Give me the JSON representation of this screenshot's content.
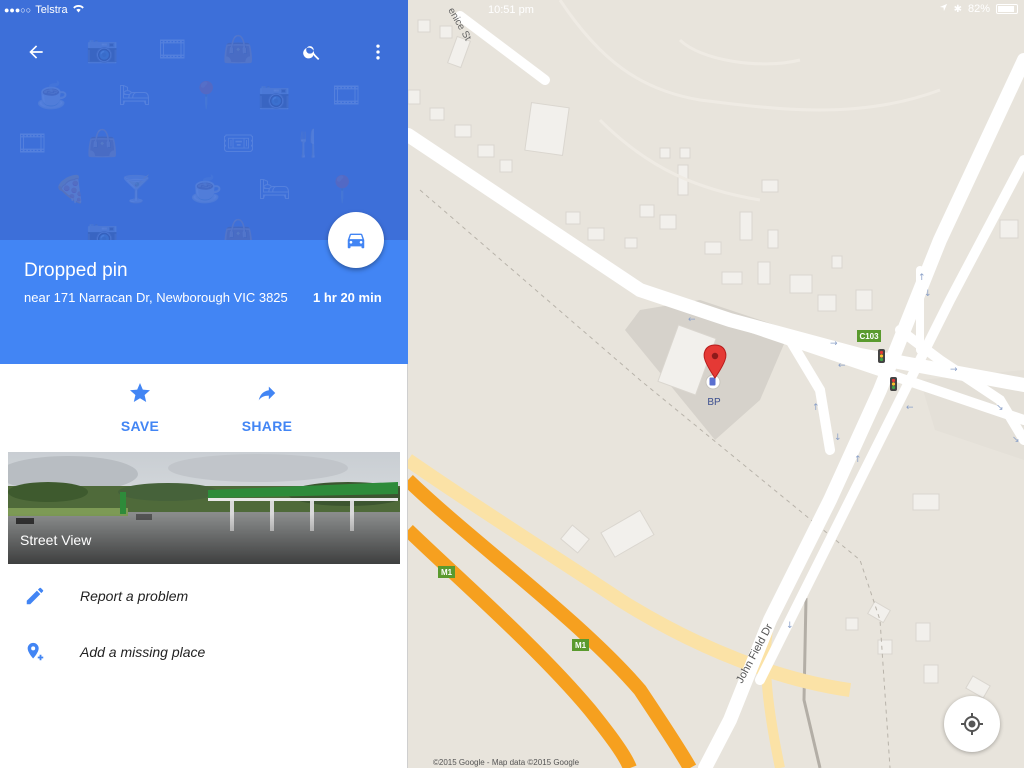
{
  "status_bar": {
    "signal": "●●●○○",
    "carrier": "Telstra",
    "time": "10:51 pm",
    "battery": "82%"
  },
  "header": {
    "back_icon": "arrow-left-icon",
    "search_icon": "search-icon",
    "more_icon": "more-vert-icon"
  },
  "place": {
    "title": "Dropped pin",
    "address": "near 171 Narracan Dr, Newborough VIC 3825",
    "drive_time": "1 hr 20 min"
  },
  "actions": {
    "save_label": "SAVE",
    "share_label": "SHARE"
  },
  "street_view": {
    "label": "Street View"
  },
  "menu": [
    {
      "label": "Report a problem",
      "icon": "pencil-icon"
    },
    {
      "label": "Add a missing place",
      "icon": "add-place-icon"
    }
  ],
  "map": {
    "street_labels": [
      "enice St",
      "John Field Dr"
    ],
    "road_shields": [
      "C103",
      "M1",
      "M1"
    ],
    "poi_label": "BP",
    "copyright": "©2015 Google - Map data ©2015 Google"
  },
  "colors": {
    "accent": "#4285f4",
    "hero": "#3d6fd9",
    "map_bg": "#e8e4dc",
    "freeway": "#f6a01f",
    "shield_green": "#5a9a2e",
    "pin_red": "#e53935"
  }
}
